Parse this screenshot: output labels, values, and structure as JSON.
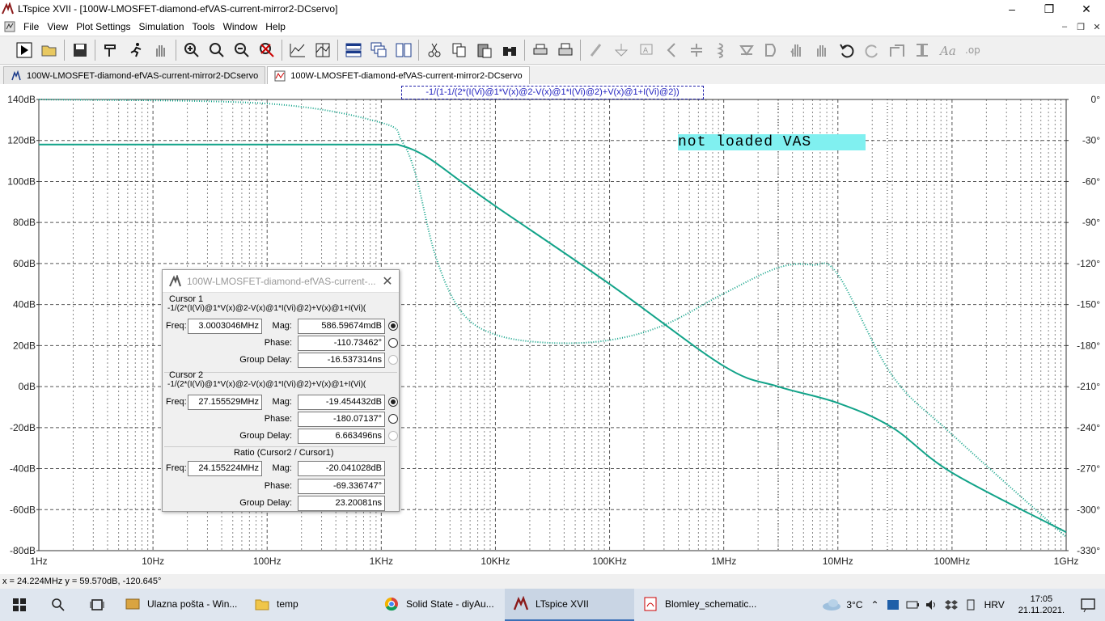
{
  "window": {
    "title": "LTspice XVII - [100W-LMOSFET-diamond-efVAS-current-mirror2-DCservo]",
    "minimize_icon": "minimize-icon",
    "maximize_icon": "restore-icon",
    "close_icon": "close-icon"
  },
  "menu": [
    "File",
    "View",
    "Plot Settings",
    "Simulation",
    "Tools",
    "Window",
    "Help"
  ],
  "toolbar": [
    "run",
    "open",
    "save",
    "control-panel",
    "halt",
    "pan",
    "zoom-in",
    "zoom-out",
    "zoom-full",
    "zoom-cancel",
    "autorange",
    "tile-horizontal",
    "tile-vertical",
    "cascade",
    "cut",
    "copy",
    "paste",
    "find",
    "print",
    "print-preview",
    "draw-wire",
    "ground",
    "label",
    "resistor",
    "capacitor",
    "inductor",
    "diode",
    "component",
    "move",
    "drag",
    "undo",
    "redo",
    "rotate",
    "mirror",
    "text",
    "spice-directive"
  ],
  "tabs": [
    {
      "label": "100W-LMOSFET-diamond-efVAS-current-mirror2-DCservo",
      "icon": "schematic-icon"
    },
    {
      "label": "100W-LMOSFET-diamond-efVAS-current-mirror2-DCservo",
      "icon": "waveform-icon"
    }
  ],
  "plot": {
    "trace_expression": "-1/(1-1/(2*(I(Vi)@1*V(x)@2-V(x)@1*I(Vi)@2)+V(x)@1+I(Vi)@2))",
    "annotation": "not loaded VAS",
    "trace_color": "#12a389",
    "y_left_ticks": [
      "140dB",
      "120dB",
      "100dB",
      "80dB",
      "60dB",
      "40dB",
      "20dB",
      "0dB",
      "-20dB",
      "-40dB",
      "-60dB",
      "-80dB"
    ],
    "y_right_ticks": [
      "0°",
      "-30°",
      "-60°",
      "-90°",
      "-120°",
      "-150°",
      "-180°",
      "-210°",
      "-240°",
      "-270°",
      "-300°",
      "-330°"
    ],
    "x_ticks": [
      "1Hz",
      "10Hz",
      "100Hz",
      "1KHz",
      "10KHz",
      "100KHz",
      "1MHz",
      "10MHz",
      "100MHz",
      "1GHz"
    ]
  },
  "chart_data": {
    "type": "line",
    "title": "-1/(1-1/(2*(I(Vi)@1*V(x)@2-V(x)@1*I(Vi)@2)+V(x)@1+I(Vi)@2))",
    "x_scale": "log",
    "xlim": [
      1,
      1000000000
    ],
    "ylim": [
      -80,
      140
    ],
    "y2lim": [
      -330,
      0
    ],
    "grid": true,
    "series": [
      {
        "axis": "left",
        "x": [
          1,
          100,
          1000,
          1500,
          2500,
          5000,
          10000,
          100000,
          1000000,
          3000000,
          10000000,
          30000000,
          100000000,
          1000000000
        ],
        "y": [
          118,
          118,
          118,
          117.5,
          112,
          100,
          88,
          50,
          10,
          0,
          -8,
          -20,
          -42,
          -71
        ]
      },
      {
        "axis": "right",
        "x": [
          1,
          100,
          1000,
          1500,
          2000,
          3000,
          5000,
          10000,
          30000,
          100000,
          300000,
          1000000,
          3000000,
          6000000,
          10000000,
          30000000,
          100000000,
          1000000000
        ],
        "y": [
          0,
          -3,
          -17,
          -30,
          -55,
          -115,
          -155,
          -172,
          -178,
          -176,
          -165,
          -142,
          -123,
          -121,
          -128,
          -202,
          -245,
          -320
        ]
      }
    ]
  },
  "cursor_window": {
    "title": "100W-LMOSFET-diamond-efVAS-current-...",
    "cursor1": {
      "heading": "Cursor 1",
      "expression": "-1/(2*(I(Vi)@1*V(x)@2-V(x)@1*I(Vi)@2)+V(x)@1+I(Vi)(",
      "freq_label": "Freq:",
      "freq": "3.0003046MHz",
      "mag_label": "Mag:",
      "mag": "586.59674mdB",
      "phase_label": "Phase:",
      "phase": "-110.73462°",
      "gd_label": "Group Delay:",
      "gd": "-16.537314ns"
    },
    "cursor2": {
      "heading": "Cursor 2",
      "expression": "-1/(2*(I(Vi)@1*V(x)@2-V(x)@1*I(Vi)@2)+V(x)@1+I(Vi)(",
      "freq_label": "Freq:",
      "freq": "27.155529MHz",
      "mag_label": "Mag:",
      "mag": "-19.454432dB",
      "phase_label": "Phase:",
      "phase": "-180.07137°",
      "gd_label": "Group Delay:",
      "gd": "6.663496ns"
    },
    "ratio": {
      "heading": "Ratio (Cursor2 / Cursor1)",
      "freq_label": "Freq:",
      "freq": "24.155224MHz",
      "mag_label": "Mag:",
      "mag": "-20.041028dB",
      "phase_label": "Phase:",
      "phase": "-69.336747°",
      "gd_label": "Group Delay:",
      "gd": "23.20081ns"
    }
  },
  "status": "x = 24.224MHz   y = 59.570dB, -120.645°",
  "taskbar": {
    "apps": [
      {
        "label": "Ulazna pošta - Win...",
        "icon": "mail-icon"
      },
      {
        "label": "temp",
        "icon": "folder-icon"
      },
      {
        "label": "Solid State - diyAu...",
        "icon": "chrome-icon"
      },
      {
        "label": "LTspice XVII",
        "icon": "ltspice-icon"
      },
      {
        "label": "Blomley_schematic...",
        "icon": "pdf-icon"
      }
    ],
    "temperature": "3°C",
    "language": "HRV",
    "time": "17:05",
    "date": "21.11.2021."
  }
}
